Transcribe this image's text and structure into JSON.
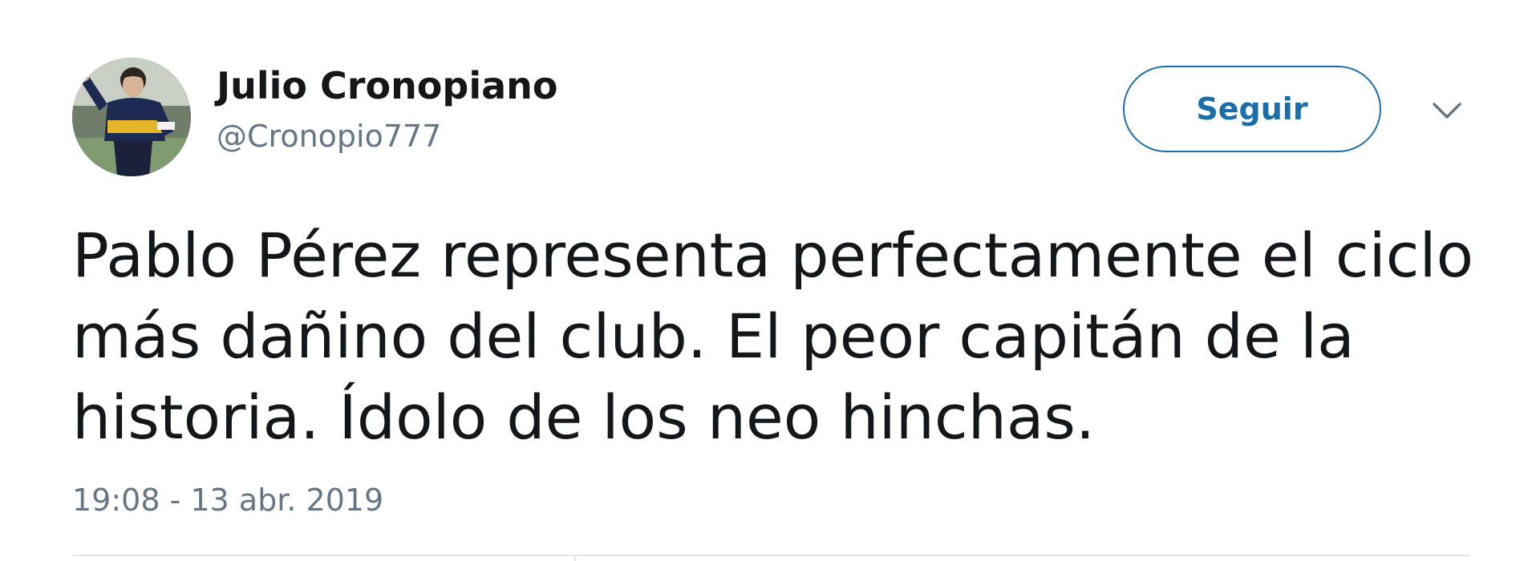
{
  "user": {
    "display_name": "Julio Cronopiano",
    "handle": "@Cronopio777",
    "avatar_icon": "profile-photo-icon"
  },
  "actions": {
    "follow_label": "Seguir",
    "more_icon": "chevron-down-icon"
  },
  "tweet": {
    "text": "Pablo Pérez representa perfectamente el ciclo más dañino del club. El peor capitán de la historia. Ídolo de los neo hinchas.",
    "timestamp": "19:08 - 13 abr. 2019"
  },
  "colors": {
    "text_primary": "#14171a",
    "text_secondary": "#657786",
    "accent": "#1b6ea8",
    "divider": "#e1e8ed"
  }
}
